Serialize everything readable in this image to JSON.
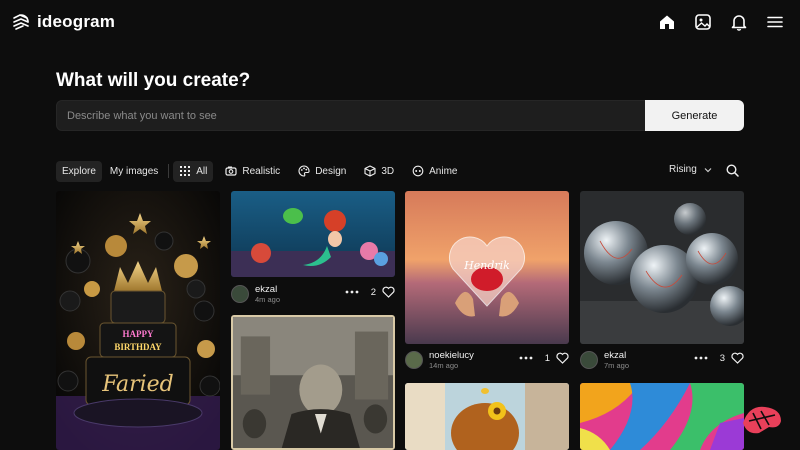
{
  "app": {
    "brand": "ideogram",
    "brand_color": "#ffffff"
  },
  "topnav": {
    "icons": [
      "home-icon",
      "gallery-icon",
      "bell-icon",
      "menu-icon"
    ]
  },
  "hero": {
    "title": "What will you create?",
    "prompt_placeholder": "Describe what you want to see",
    "prompt_value": "",
    "generate_label": "Generate"
  },
  "filters": {
    "explore_label": "Explore",
    "my_images_label": "My images",
    "categories": [
      {
        "label": "All",
        "icon": "grid-icon",
        "active": true
      },
      {
        "label": "Realistic",
        "icon": "camera-icon"
      },
      {
        "label": "Design",
        "icon": "palette-icon"
      },
      {
        "label": "3D",
        "icon": "cube-icon"
      },
      {
        "label": "Anime",
        "icon": "anime-face-icon"
      }
    ],
    "sort_label": "Rising"
  },
  "feed": {
    "cards": [
      {
        "subject": "birthday cake Faried",
        "cake_name": "Faried",
        "cake_text_1": "HAPPY",
        "cake_text_2": "BIRTHDAY"
      },
      {
        "subject": "mermaid",
        "user": "ekzal",
        "time": "4m ago",
        "likes": "2"
      },
      {
        "subject": "old man photo"
      },
      {
        "subject": "heart Hendrik",
        "heart_text": "Hendrik",
        "user": "noekielucy",
        "time": "14m ago",
        "likes": "1"
      },
      {
        "subject": "glass spheres",
        "user": "ekzal",
        "time": "7m ago",
        "likes": "3"
      },
      {
        "subject": "anime girl sunflower"
      },
      {
        "subject": "paint colors"
      }
    ]
  },
  "colors": {
    "background": "#0d0d0d",
    "input_bg": "#1e1e1e",
    "button_bg": "#f2f2f2",
    "badge": "#e8405a"
  }
}
